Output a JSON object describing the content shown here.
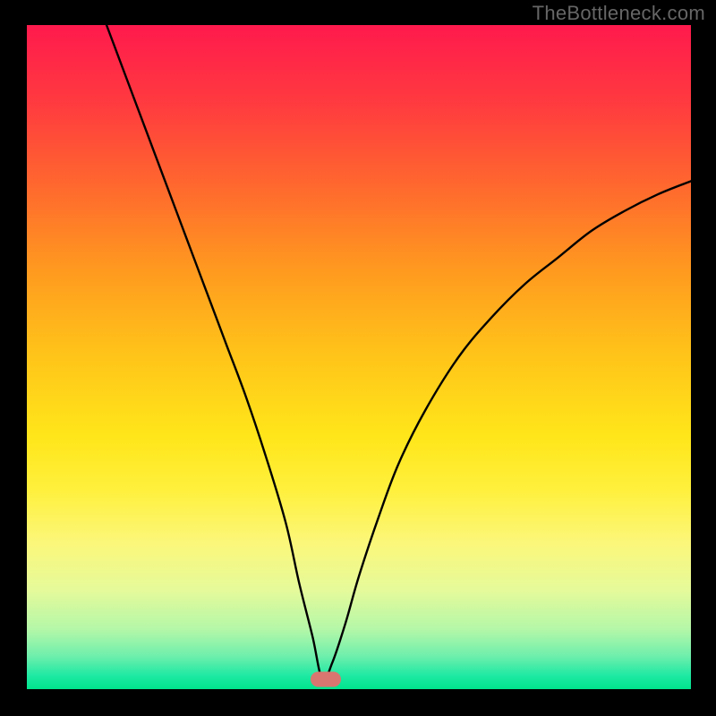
{
  "watermark": "TheBottleneck.com",
  "colors": {
    "frame": "#000000",
    "watermark_text": "#666666",
    "curve": "#000000",
    "marker": "#d9766f",
    "gradient_top": "#ff1a4d",
    "gradient_bottom": "#00e48c"
  },
  "chart_data": {
    "type": "line",
    "title": "",
    "xlabel": "",
    "ylabel": "",
    "xlim": [
      0,
      100
    ],
    "ylim": [
      0,
      100
    ],
    "grid": false,
    "legend": false,
    "annotations": [
      {
        "name": "marker",
        "x": 45,
        "y": 1.5,
        "shape": "rounded-rect",
        "color": "#d9766f"
      }
    ],
    "series": [
      {
        "name": "bottleneck-curve",
        "x": [
          12,
          15,
          18,
          21,
          24,
          27,
          30,
          33,
          36,
          39,
          41,
          43,
          44.5,
          46,
          48,
          50,
          53,
          56,
          60,
          65,
          70,
          75,
          80,
          85,
          90,
          95,
          100
        ],
        "y": [
          100,
          92,
          84,
          76,
          68,
          60,
          52,
          44,
          35,
          25,
          16,
          8,
          1.5,
          4,
          10,
          17,
          26,
          34,
          42,
          50,
          56,
          61,
          65,
          69,
          72,
          74.5,
          76.5
        ]
      }
    ],
    "background_gradient": {
      "direction": "vertical",
      "stops": [
        {
          "pos": 0.0,
          "color": "#ff1a4d"
        },
        {
          "pos": 0.5,
          "color": "#ffe61a"
        },
        {
          "pos": 0.95,
          "color": "#6fefac"
        },
        {
          "pos": 1.0,
          "color": "#00e48c"
        }
      ]
    }
  }
}
